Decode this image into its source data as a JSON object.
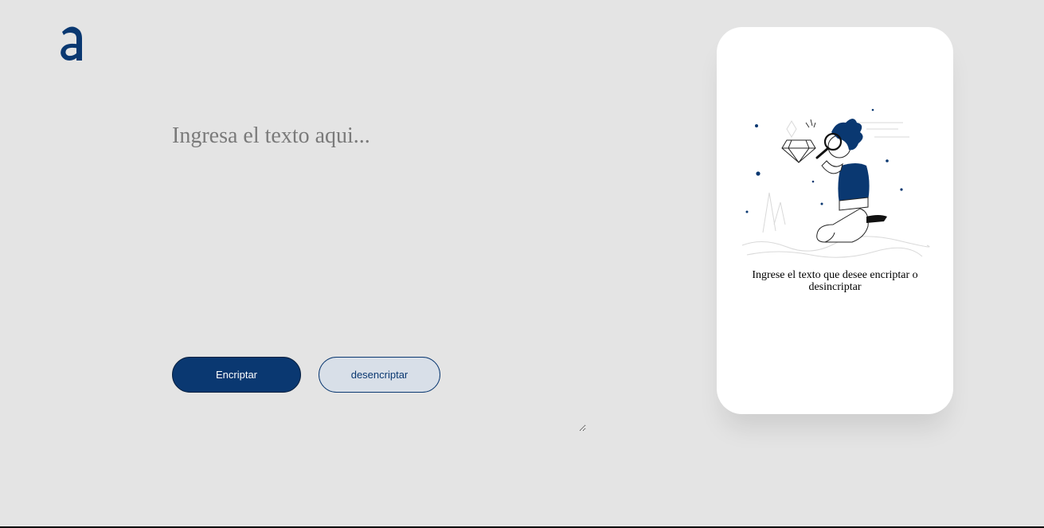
{
  "app": {
    "logo_icon": "alura-a-logo",
    "brand_color": "#0a3871",
    "background_color": "#e4e4e4"
  },
  "main": {
    "input": {
      "placeholder": "Ingresa el texto aqui...",
      "value": ""
    },
    "buttons": {
      "encrypt_label": "Encriptar",
      "decrypt_label": "desencriptar"
    }
  },
  "output_panel": {
    "illustration_icon": "boy-with-magnifying-glass-illustration",
    "message": "Ingrese el texto que desee encriptar o desincriptar"
  }
}
